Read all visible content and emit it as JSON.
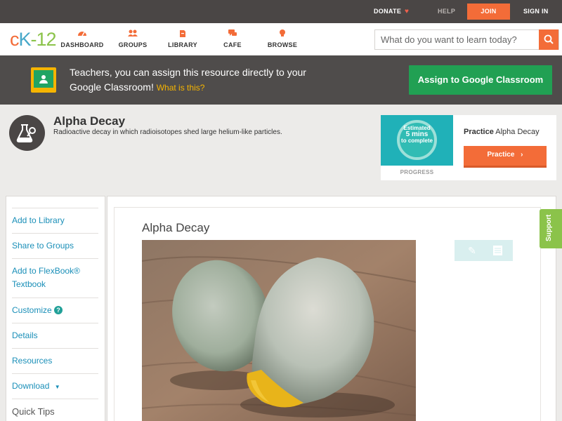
{
  "topbar": {
    "donate_label": "DONATE",
    "help_label": "HELP",
    "join_label": "JOIN",
    "signin_label": "SIGN IN"
  },
  "logo": {
    "c": "c",
    "k": "K",
    "dash": "-",
    "n12": "12"
  },
  "nav": {
    "items": [
      {
        "label": "DASHBOARD",
        "icon": "dashboard-icon"
      },
      {
        "label": "GROUPS",
        "icon": "groups-icon"
      },
      {
        "label": "LIBRARY",
        "icon": "library-icon"
      },
      {
        "label": "CAFE",
        "icon": "cafe-icon"
      },
      {
        "label": "BROWSE",
        "icon": "browse-icon"
      }
    ]
  },
  "search": {
    "placeholder": "What do you want to learn today?",
    "value": ""
  },
  "classroom_banner": {
    "text": "Teachers, you can assign this resource directly to your Google Classroom!",
    "link": "What is this?",
    "button": "Assign to Google Classroom"
  },
  "concept": {
    "title": "Alpha Decay",
    "description": "Radioactive decay in which radioisotopes shed large helium-like particles."
  },
  "practice": {
    "estimated_line1": "Estimated",
    "estimated_line2": "5 mins",
    "estimated_line3": "to complete",
    "progress_label": "PROGRESS",
    "title_prefix": "Practice",
    "title_topic": "Alpha Decay",
    "button": "Practice"
  },
  "sidebar": {
    "items": [
      {
        "label": "Add to Library"
      },
      {
        "label": "Share to Groups"
      },
      {
        "label": "Add to FlexBook® Textbook"
      },
      {
        "label": "Customize"
      },
      {
        "label": "Details"
      },
      {
        "label": "Resources"
      },
      {
        "label": "Download"
      },
      {
        "label": "Quick Tips"
      }
    ]
  },
  "article": {
    "title": "Alpha Decay"
  },
  "support_label": "Support",
  "colors": {
    "brand_orange": "#f36c38",
    "link_blue": "#1a8fb8",
    "google_green": "#21a053",
    "support_green": "#8bc34a"
  }
}
